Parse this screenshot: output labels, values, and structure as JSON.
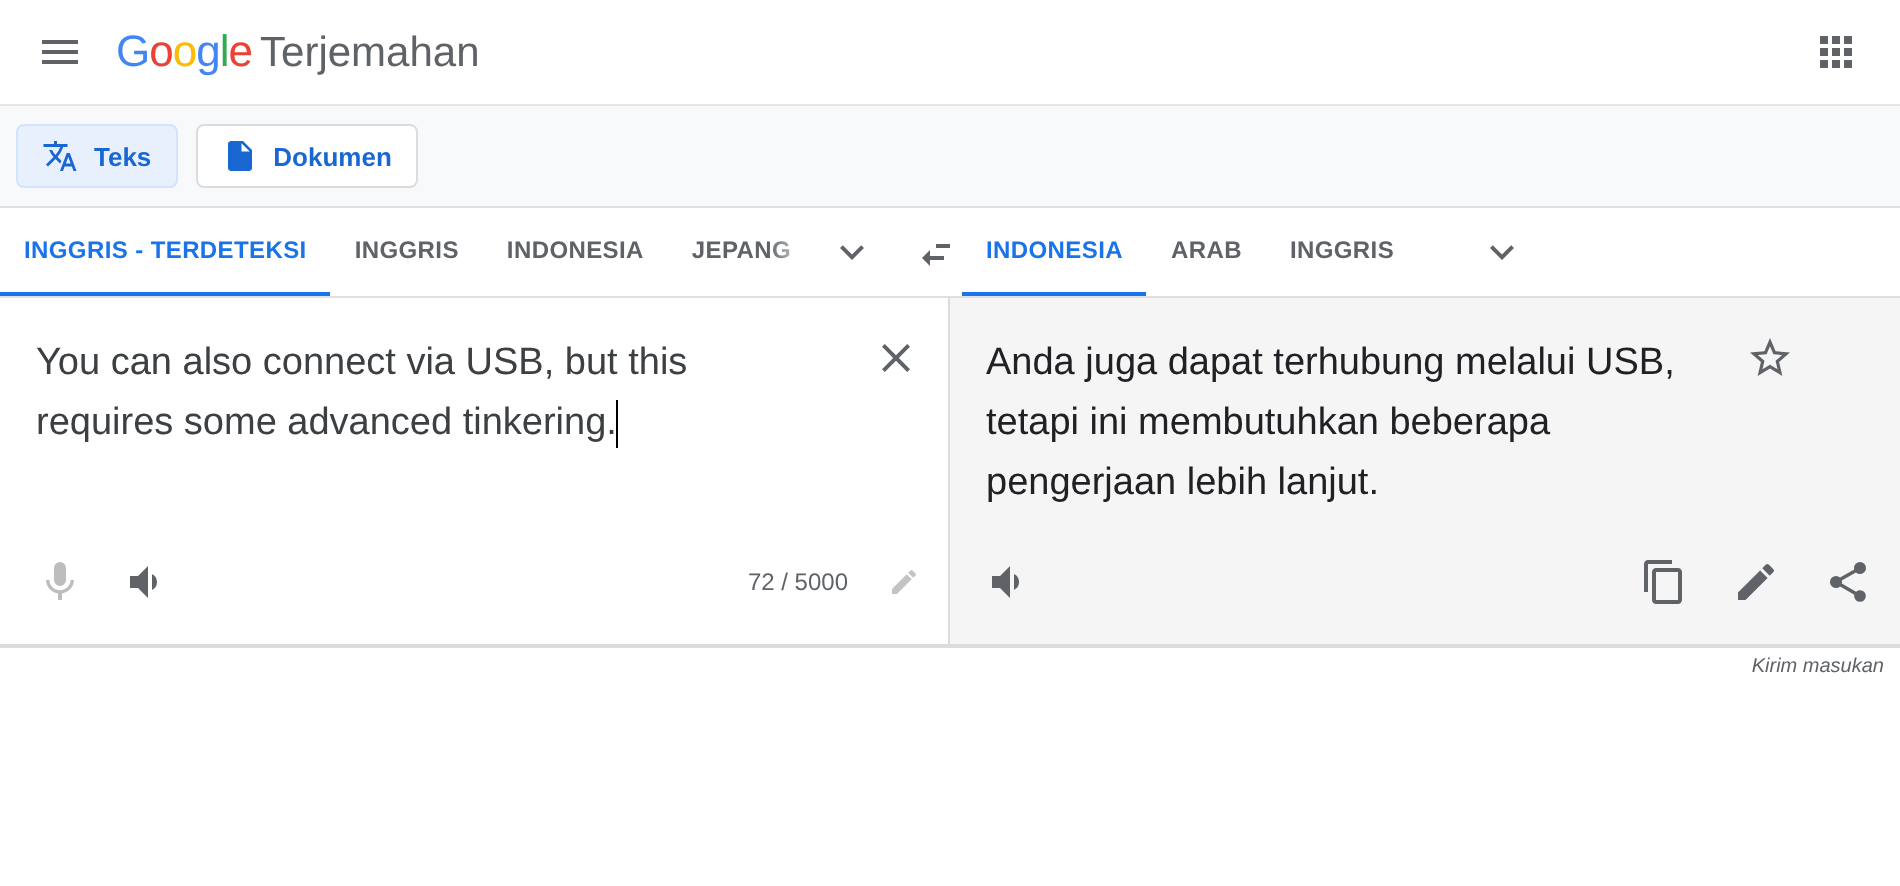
{
  "header": {
    "logo": "Google",
    "product": "Terjemahan"
  },
  "modes": [
    {
      "label": "Teks",
      "kind": "text",
      "selected": true
    },
    {
      "label": "Dokumen",
      "kind": "document",
      "selected": false
    }
  ],
  "source_languages": [
    {
      "label": "INGGRIS - TERDETEKSI",
      "selected": true
    },
    {
      "label": "INGGRIS",
      "selected": false
    },
    {
      "label": "INDONESIA",
      "selected": false
    },
    {
      "label": "JEPANG",
      "selected": false
    }
  ],
  "target_languages": [
    {
      "label": "INDONESIA",
      "selected": true
    },
    {
      "label": "ARAB",
      "selected": false
    },
    {
      "label": "INGGRIS",
      "selected": false
    }
  ],
  "source": {
    "text": "You can also connect via USB, but this requires some advanced tinkering.",
    "char_count": "72 / 5000"
  },
  "target": {
    "text": "Anda juga dapat terhubung melalui USB, tetapi ini membutuhkan beberapa pengerjaan lebih lanjut."
  },
  "feedback": "Kirim masukan"
}
